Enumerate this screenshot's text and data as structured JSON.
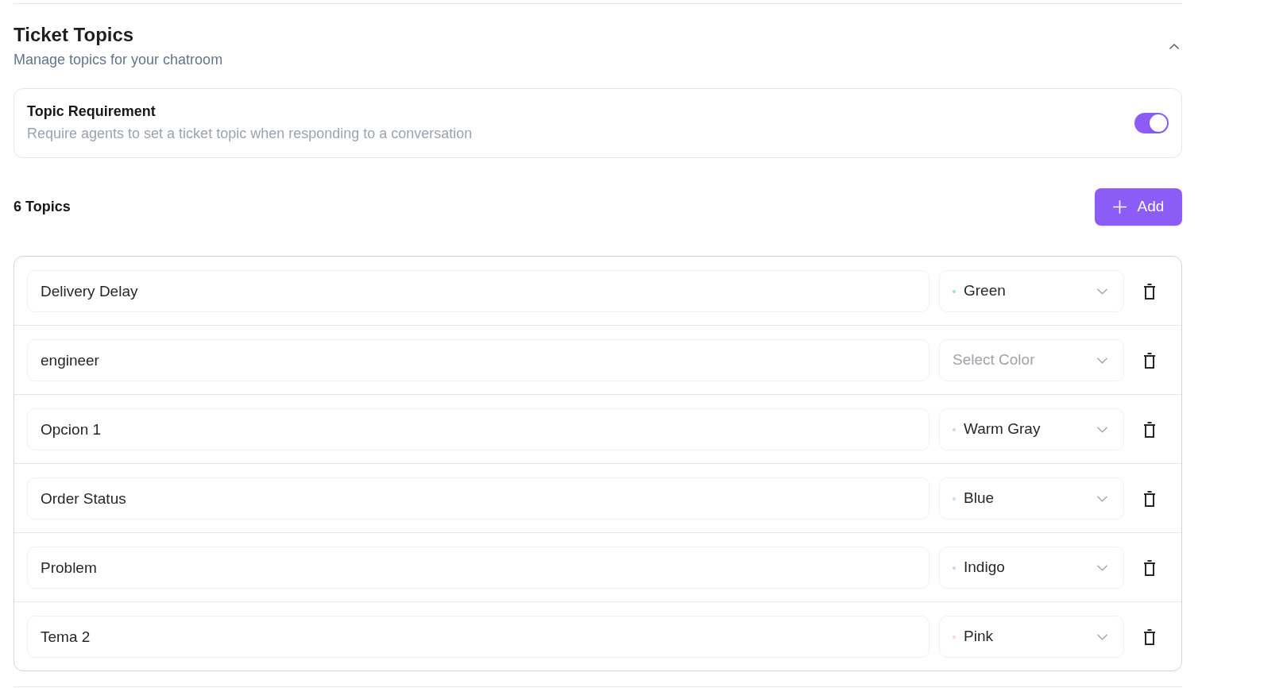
{
  "section": {
    "title": "Ticket Topics",
    "subtitle": "Manage topics for your chatroom",
    "expanded": true
  },
  "topic_requirement": {
    "title": "Topic Requirement",
    "description": "Require agents to set a ticket topic when responding to a conversation",
    "on": true
  },
  "topics_header": {
    "count": "6 Topics",
    "add_button": "Add"
  },
  "topics": [
    {
      "name": "Delivery Delay",
      "color_name": "Green",
      "color": "#86efac"
    },
    {
      "name": "engineer",
      "color_placeholder": "Select Color"
    },
    {
      "name": "Opcion 1",
      "color_name": "Warm Gray",
      "color": "#d6d3d1"
    },
    {
      "name": "Order Status",
      "color_name": "Blue",
      "color": "#bfdbfe"
    },
    {
      "name": "Problem",
      "color_name": "Indigo",
      "color": "#c7d2fe"
    },
    {
      "name": "Tema 2",
      "color_name": "Pink",
      "color": "#fbcfe8"
    }
  ]
}
